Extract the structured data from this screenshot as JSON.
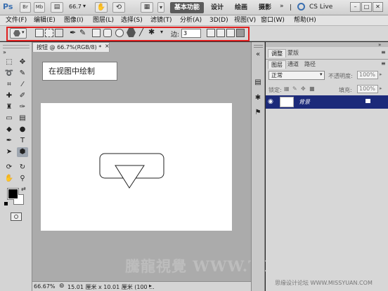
{
  "appbar": {
    "logo": "Ps",
    "br_label": "Br",
    "mb_label": "Mb",
    "zoom": "66.7",
    "workspaces": [
      "基本功能",
      "设计",
      "绘画",
      "摄影"
    ],
    "cslive": "CS Live",
    "minimize": "–",
    "maximize": "□",
    "close": "✕"
  },
  "menubar": {
    "items": [
      "文件(F)",
      "编辑(E)",
      "图像(I)",
      "图层(L)",
      "选择(S)",
      "滤镜(T)",
      "分析(A)",
      "3D(D)",
      "视图(V)",
      "窗口(W)",
      "帮助(H)"
    ]
  },
  "options": {
    "edge_label": "边:",
    "edge_value": "3"
  },
  "document": {
    "tab_title": "按钮 @ 66.7%(RGB/8) *",
    "close_glyph": "×",
    "note": "在视图中绘制"
  },
  "status": {
    "zoom": "66.67%",
    "info": "15.01 厘米 x 10.01 厘米 (100 ..."
  },
  "panels": {
    "top_tabs": [
      "调整",
      "蒙版"
    ],
    "layer_tabs": [
      "图层",
      "通道",
      "路径"
    ],
    "blend_mode": "正常",
    "opacity_label": "不透明度:",
    "opacity_value": "100%",
    "lock_label": "锁定:",
    "fill_label": "填充:",
    "fill_value": "100%",
    "layer_name": "背景"
  },
  "watermark": {
    "logo_text": "騰龍視覺 WWW.TLVI.NET",
    "forum": "思缘设计论坛 WWW.MISSYUAN.COM"
  },
  "colors": {
    "highlight_box": "#e02020",
    "layer_selected": "#1c2a7a"
  }
}
